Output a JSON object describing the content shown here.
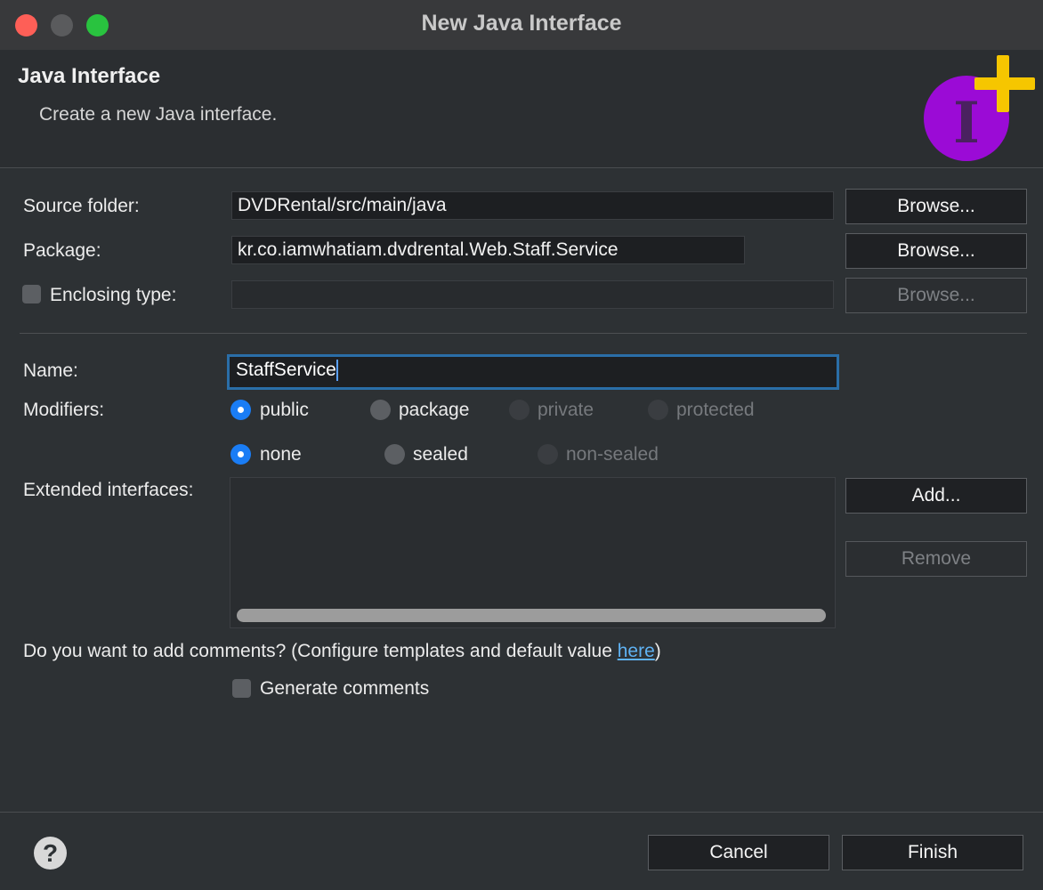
{
  "window": {
    "title": "New Java Interface",
    "controls": [
      "close-button",
      "minimize-button",
      "zoom-button"
    ]
  },
  "header": {
    "title": "Java Interface",
    "description": "Create a new Java interface.",
    "icon": "new-interface-icon",
    "icon_letter": "I",
    "icon_colors": {
      "circle": "#9b0bd6",
      "plus": "#f6c600"
    }
  },
  "form": {
    "source_folder": {
      "label": "Source folder:",
      "value": "DVDRental/src/main/java",
      "browse_label": "Browse..."
    },
    "package": {
      "label": "Package:",
      "value": "kr.co.iamwhatiam.dvdrental.Web.Staff.Service",
      "browse_label": "Browse..."
    },
    "enclosing_type": {
      "label": "Enclosing type:",
      "checked": false,
      "value": "",
      "browse_label": "Browse..."
    },
    "name": {
      "label": "Name:",
      "value": "StaffService"
    },
    "modifiers": {
      "label": "Modifiers:",
      "access": [
        {
          "label": "public",
          "selected": true,
          "enabled": true
        },
        {
          "label": "package",
          "selected": false,
          "enabled": true
        },
        {
          "label": "private",
          "selected": false,
          "enabled": false
        },
        {
          "label": "protected",
          "selected": false,
          "enabled": false
        }
      ],
      "sealing": [
        {
          "label": "none",
          "selected": true,
          "enabled": true
        },
        {
          "label": "sealed",
          "selected": false,
          "enabled": true
        },
        {
          "label": "non-sealed",
          "selected": false,
          "enabled": false
        }
      ]
    },
    "extended_interfaces": {
      "label": "Extended interfaces:",
      "add_label": "Add...",
      "remove_label": "Remove"
    },
    "comments": {
      "question_prefix": "Do you want to add comments? (Configure templates and default value ",
      "link_text": "here",
      "question_suffix": ")",
      "generate_label": "Generate comments",
      "generate_checked": false
    }
  },
  "footer": {
    "help_glyph": "?",
    "cancel_label": "Cancel",
    "finish_label": "Finish"
  },
  "colors": {
    "accent": "#1a7df5",
    "focus_ring": "#2a6ea8",
    "link": "#5fb2f3",
    "background": "#2d3134"
  }
}
